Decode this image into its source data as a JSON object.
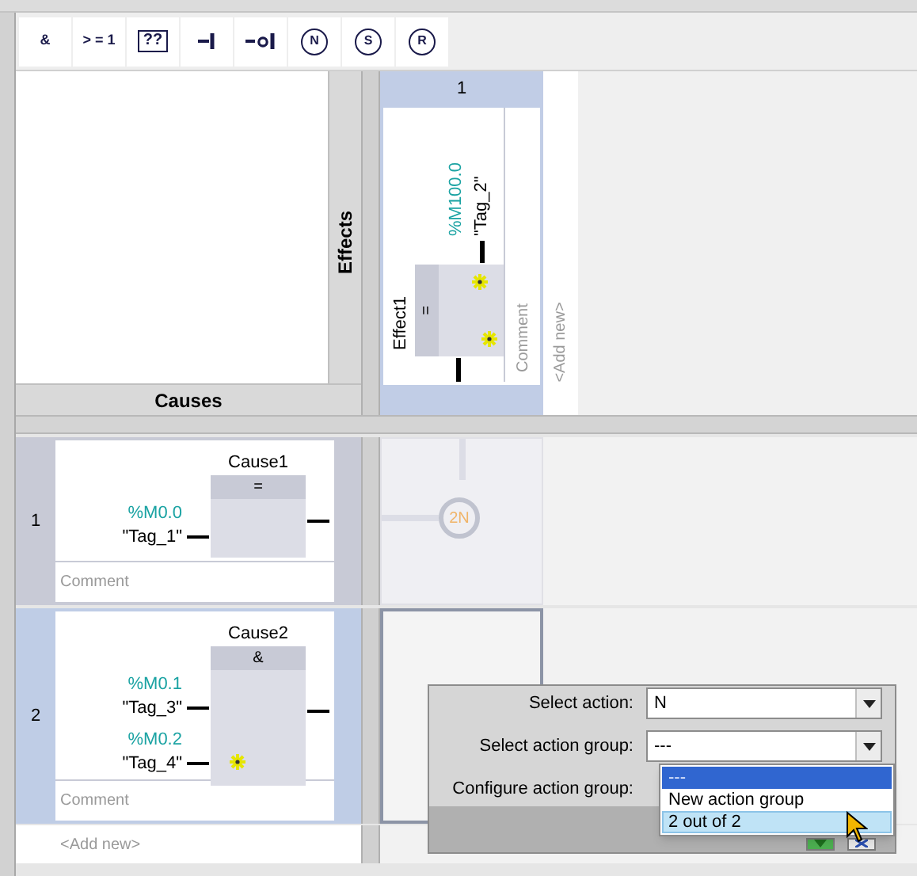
{
  "toolbar": [
    {
      "kind": "text",
      "label": "&"
    },
    {
      "kind": "text",
      "label": "> = 1"
    },
    {
      "kind": "box",
      "label": "??"
    },
    {
      "kind": "contact"
    },
    {
      "kind": "negated_contact"
    },
    {
      "kind": "coil",
      "label": "N"
    },
    {
      "kind": "coil",
      "label": "S"
    },
    {
      "kind": "coil",
      "label": "R"
    }
  ],
  "effects_header": "Effects",
  "causes_header": "Causes",
  "effects": [
    {
      "number": "1",
      "name": "Effect1",
      "instruction": "=",
      "address": "%M100.0",
      "tag": "\"Tag_2\"",
      "comment": "Comment"
    }
  ],
  "effects_add_new": "<Add new>",
  "causes": [
    {
      "number": "1",
      "name": "Cause1",
      "instruction": "=",
      "selected": false,
      "empty_input": false,
      "inputs": [
        {
          "address": "%M0.0",
          "tag": "\"Tag_1\""
        }
      ],
      "comment": "Comment"
    },
    {
      "number": "2",
      "name": "Cause2",
      "instruction": "&",
      "selected": true,
      "empty_input": true,
      "inputs": [
        {
          "address": "%M0.1",
          "tag": "\"Tag_3\""
        },
        {
          "address": "%M0.2",
          "tag": "\"Tag_4\""
        }
      ],
      "comment": "Comment"
    }
  ],
  "causes_add_new": "<Add new>",
  "intersection": {
    "label": "2N"
  },
  "popup": {
    "fields": [
      {
        "label": "Select action:",
        "value": "N"
      },
      {
        "label": "Select action group:",
        "value": "---"
      },
      {
        "label": "Configure action group:"
      }
    ],
    "options": [
      {
        "label": "---",
        "selected": true,
        "hovered": false
      },
      {
        "label": "New action group",
        "selected": false,
        "hovered": false
      },
      {
        "label": "2 out of 2",
        "selected": false,
        "hovered": true
      }
    ]
  }
}
